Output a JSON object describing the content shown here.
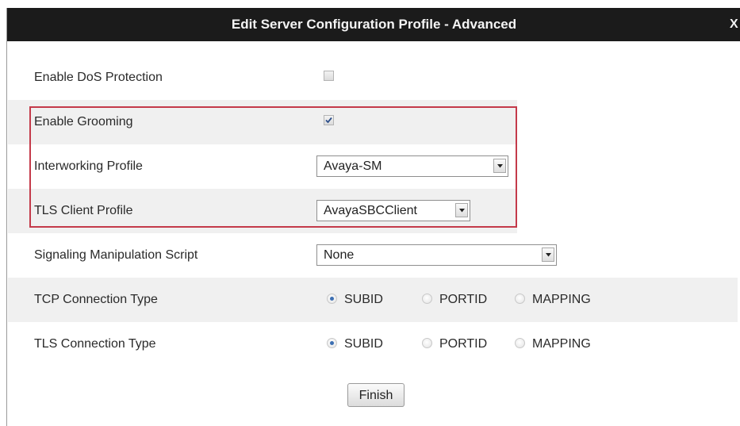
{
  "dialog": {
    "title": "Edit Server Configuration Profile - Advanced",
    "close_label": "X"
  },
  "fields": {
    "enable_dos_protection": {
      "label": "Enable DoS Protection",
      "checked": false
    },
    "enable_grooming": {
      "label": "Enable Grooming",
      "checked": true
    },
    "interworking_profile": {
      "label": "Interworking Profile",
      "value": "Avaya-SM"
    },
    "tls_client_profile": {
      "label": "TLS Client Profile",
      "value": "AvayaSBCClient"
    },
    "signaling_manipulation_script": {
      "label": "Signaling Manipulation Script",
      "value": "None"
    },
    "tcp_connection_type": {
      "label": "TCP Connection Type",
      "options": [
        "SUBID",
        "PORTID",
        "MAPPING"
      ],
      "selected": "SUBID"
    },
    "tls_connection_type": {
      "label": "TLS Connection Type",
      "options": [
        "SUBID",
        "PORTID",
        "MAPPING"
      ],
      "selected": "SUBID"
    }
  },
  "actions": {
    "finish_label": "Finish"
  },
  "colors": {
    "titlebar_bg": "#1b1b1b",
    "row_shade": "#f0f0f0",
    "highlight_border": "#c43a4a",
    "radio_selected": "#3d6fb2"
  }
}
